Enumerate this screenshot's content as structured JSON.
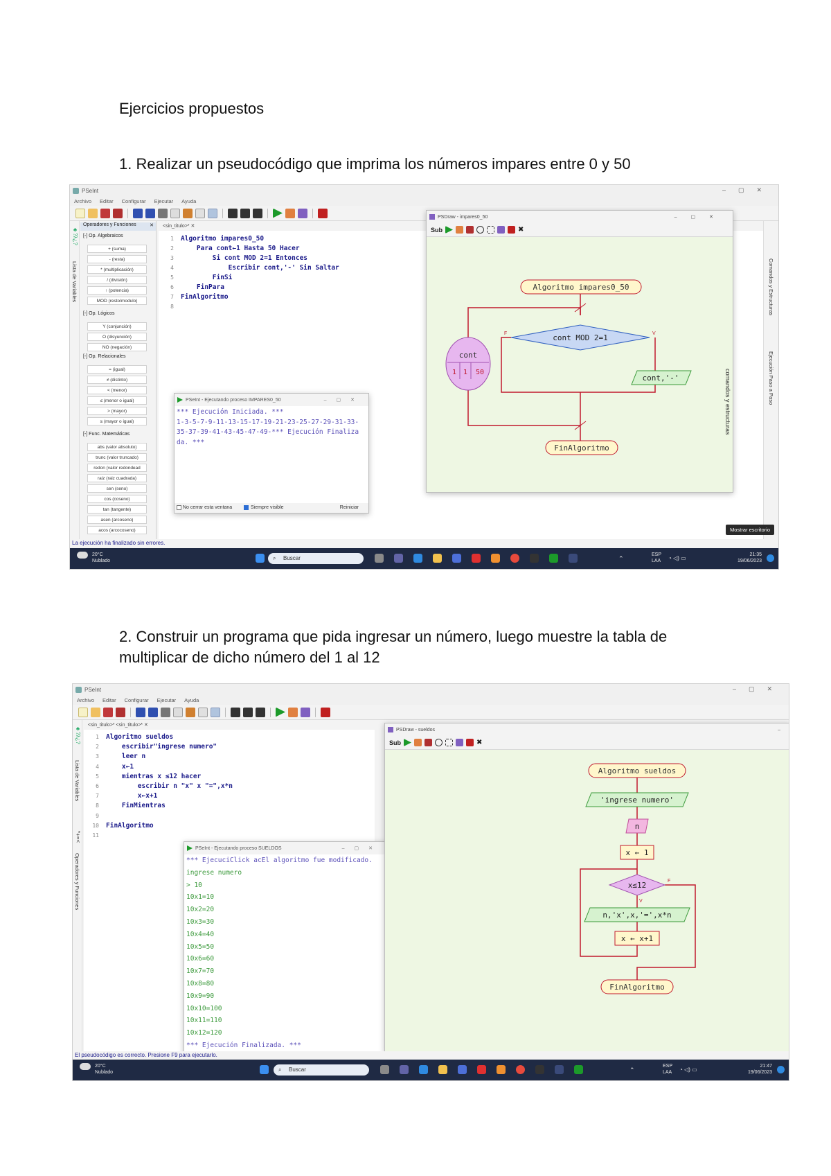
{
  "document": {
    "heading": "Ejercicios propuestos",
    "ex1_text": "1. Realizar un pseudocódigo que imprima los números impares entre 0 y 50",
    "ex2_line1": "2. Construir un programa que pida ingresar un número, luego muestre la tabla de",
    "ex2_line2": "multiplicar de dicho número del 1 al 12"
  },
  "shot1": {
    "app_title": "PSeInt",
    "menu": [
      "Archivo",
      "Editar",
      "Configurar",
      "Ejecutar",
      "Ayuda"
    ],
    "panel_tab": "Operadores y Funciones",
    "sections": {
      "algebraicos": "[-]  Op. Algebraicos",
      "logicos": "[-]  Op. Lógicos",
      "relacionales": "[-]  Op. Relacionales",
      "matematicas": "[-]  Func. Matemáticas"
    },
    "algebraic_ops": [
      "+ (suma)",
      "- (resta)",
      "* (multiplicación)",
      "/ (división)",
      "↑ (potencia)",
      "MOD (resto/modulo)"
    ],
    "logical_ops": [
      "Y (conjunción)",
      "O (disyunción)",
      "NO (negación)"
    ],
    "relational_ops": [
      "= (igual)",
      "≠ (distinto)",
      "< (menor)",
      "≤ (menor o igual)",
      "> (mayor)",
      "≥ (mayor o igual)"
    ],
    "math_funcs": [
      "abs (valor absoluto)",
      "trunc (valor truncado)",
      "redon (valor redondead",
      "raiz (raiz cuadrada)",
      "sen (seno)",
      "cos (coseno)",
      "tan (tangente)",
      "asen (arcoseno)",
      "acos (arcocoseno)"
    ],
    "left_vertical": "Lista de Variables",
    "right_vertical_1": "Comandos y Estructuras",
    "right_vertical_2": "Ejecución Paso a Paso",
    "editor_tab": "<sin_titulo>*  ✕",
    "code": [
      {
        "n": "1",
        "t": "Algoritmo impares0_50"
      },
      {
        "n": "2",
        "t": "    Para cont←1 Hasta 50 Hacer"
      },
      {
        "n": "3",
        "t": "        Si cont MOD 2=1 Entonces"
      },
      {
        "n": "4",
        "t": "            Escribir cont,'-' Sin Saltar"
      },
      {
        "n": "5",
        "t": "        FinSi"
      },
      {
        "n": "6",
        "t": "    FinPara"
      },
      {
        "n": "7",
        "t": "FinAlgoritmo"
      },
      {
        "n": "8",
        "t": ""
      }
    ],
    "console_title": "PSeInt - Ejecutando proceso IMPARES0_50",
    "console_lines": [
      "*** Ejecución Iniciada. ***",
      "1-3-5-7-9-11-13-15-17-19-21-23-25-27-29-31-33-",
      "35-37-39-41-43-45-47-49-*** Ejecución Finaliza",
      "da. ***"
    ],
    "console_footer": {
      "keep_open": "No cerrar esta ventana",
      "always_visible": "Siempre visible",
      "restart": "Reiniciar"
    },
    "psdraw_title": "PSDraw - impares0_50",
    "psdraw_vertical": "comandos y estructuras",
    "flow": {
      "start": "Algoritmo impares0_50",
      "cond": "cont MOD 2=1",
      "loop_var": "cont",
      "loop_vals": [
        "1",
        "1",
        "50"
      ],
      "out": "cont,'-'",
      "end": "FinAlgoritmo",
      "false_label": "F",
      "true_label": "V"
    },
    "status": "La ejecución ha finalizado sin errores.",
    "tooltip": "Mostrar escritorio",
    "taskbar": {
      "temp": "20°C",
      "weather": "Nublado",
      "search": "Buscar",
      "lang1": "ESP",
      "lang2": "LAA",
      "time": "21:35",
      "date": "19/06/2023"
    }
  },
  "shot2": {
    "app_title": "PSeInt",
    "menu": [
      "Archivo",
      "Editar",
      "Configurar",
      "Ejecutar",
      "Ayuda"
    ],
    "editor_tabs": "<sin_titulo>*   <sin_titulo>*  ✕",
    "left_vertical_1": "Lista de Variables",
    "left_vertical_2": "Operadores y Funciones",
    "code": [
      {
        "n": "1",
        "t": "Algoritmo sueldos"
      },
      {
        "n": "2",
        "t": "    escribir\"ingrese numero\""
      },
      {
        "n": "3",
        "t": "    leer n"
      },
      {
        "n": "4",
        "t": "    x←1"
      },
      {
        "n": "5",
        "t": "    mientras x ≤12 hacer"
      },
      {
        "n": "6",
        "t": "        escribir n \"x\" x \"=\",x*n"
      },
      {
        "n": "7",
        "t": "        x←x+1"
      },
      {
        "n": "8",
        "t": "    FinMientras"
      },
      {
        "n": "9",
        "t": ""
      },
      {
        "n": "10",
        "t": "FinAlgoritmo"
      },
      {
        "n": "11",
        "t": ""
      }
    ],
    "console_title": "PSeInt - Ejecutando proceso SUELDOS",
    "console_lines": [
      "*** EjecuciClick acEl algoritmo fue modificado.",
      "ingrese numero",
      "> 10",
      "10x1=10",
      "10x2=20",
      "10x3=30",
      "10x4=40",
      "10x5=50",
      "10x6=60",
      "10x7=70",
      "10x8=80",
      "10x9=90",
      "10x10=100",
      "10x11=110",
      "10x12=120",
      "*** Ejecución Finalizada. ***"
    ],
    "psdraw_title": "PSDraw - sueldos",
    "flow": {
      "start": "Algoritmo sueldos",
      "out1": "'ingrese numero'",
      "read": "n",
      "assign": "x ← 1",
      "cond": "x≤12",
      "out2": "n,'x',x,'=',x*n",
      "inc": "x ← x+1",
      "end": "FinAlgoritmo",
      "false_label": "F",
      "true_label": "V"
    },
    "status": "El pseudocódigo es correcto. Presione F9 para ejecutarlo.",
    "taskbar": {
      "temp": "20°C",
      "weather": "Nublado",
      "search": "Buscar",
      "lang1": "ESP",
      "lang2": "LAA",
      "time": "21:47",
      "date": "19/06/2023"
    }
  },
  "colors": {
    "flow_red": "#c0182d",
    "node_yellow": "#fff7cc",
    "cond_blue": "#c8d8f4",
    "loop_pink": "#e7b7ef",
    "out_green": "#d6f2cf",
    "canvas_green": "#eef7e3"
  }
}
